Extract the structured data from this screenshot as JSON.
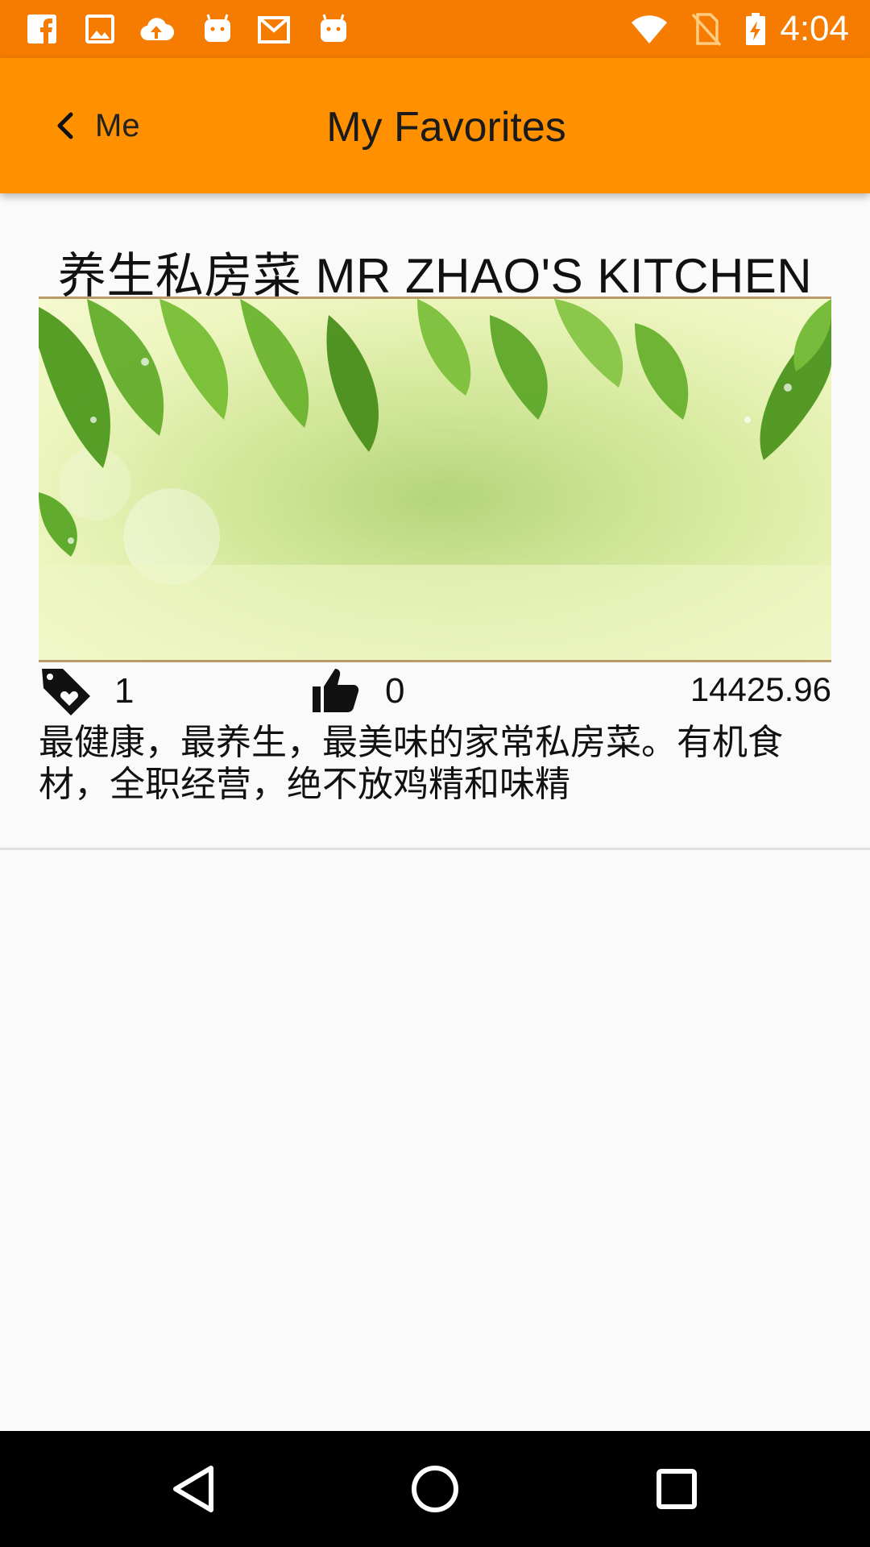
{
  "status_bar": {
    "time": "4:04",
    "left_icons": [
      "facebook-icon",
      "gallery-icon",
      "cloud-upload-icon",
      "android-icon",
      "gmail-icon",
      "android-icon"
    ],
    "right_icons": [
      "wifi-icon",
      "no-sim-icon",
      "battery-charging-icon"
    ],
    "color": "#f57c00"
  },
  "app_bar": {
    "back_label": "Me",
    "title": "My Favorites",
    "color": "#ff9100"
  },
  "favorite_item": {
    "title": "养生私房菜 MR ZHAO'S KITCHEN",
    "image": "green-leaves-banner",
    "favorites_count": "1",
    "likes_count": "0",
    "price": "14425.96",
    "description": "最健康，最养生，最美味的家常私房菜。有机食材，全职经营，绝不放鸡精和味精"
  },
  "nav_bar": {
    "buttons": [
      "back-triangle-icon",
      "home-circle-icon",
      "recents-square-icon"
    ]
  }
}
